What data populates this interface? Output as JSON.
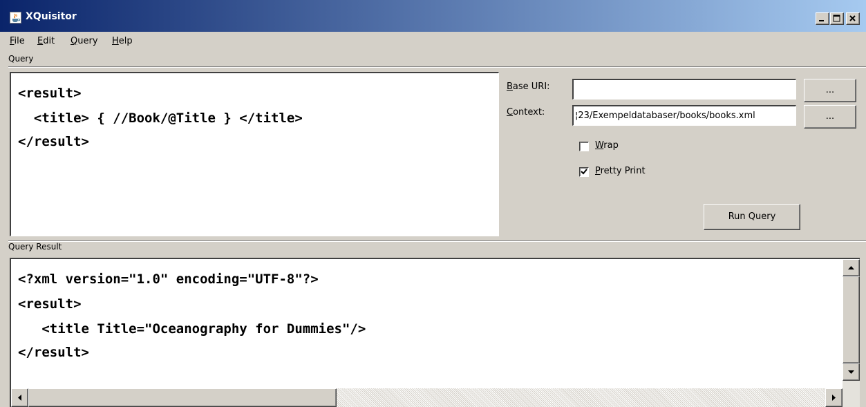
{
  "window": {
    "title": "XQuisitor",
    "icon": "java-cup-icon"
  },
  "menu": {
    "file": {
      "first": "F",
      "rest": "ile"
    },
    "edit": {
      "first": "E",
      "rest": "dit"
    },
    "query": {
      "first": "Q",
      "rest": "uery"
    },
    "help": {
      "first": "H",
      "rest": "elp"
    }
  },
  "query_panel": {
    "label": "Query",
    "lines": [
      "<result>",
      "  <title> { //Book/@Title } </title>",
      "</result>"
    ]
  },
  "options": {
    "base_uri": {
      "label_first": "B",
      "label_rest": "ase URI:",
      "value": "",
      "browse_label": "..."
    },
    "context": {
      "label_first": "C",
      "label_rest": "ontext:",
      "value": "¦23/Exempeldatabaser/books/books.xml",
      "browse_label": "..."
    },
    "wrap": {
      "label_first": "W",
      "label_rest": "rap",
      "checked": false
    },
    "pretty_print": {
      "label_first": "P",
      "label_rest": "retty Print",
      "checked": true
    },
    "run_label": "Run Query"
  },
  "result_panel": {
    "label": "Query Result",
    "lines": [
      "<?xml version=\"1.0\" encoding=\"UTF-8\"?>",
      "<result>",
      "   <title Title=\"Oceanography for Dummies\"/>",
      "</result>"
    ]
  },
  "colors": {
    "titlebar_start": "#0a246a",
    "titlebar_end": "#a6caf0",
    "face": "#d4d0c8"
  }
}
